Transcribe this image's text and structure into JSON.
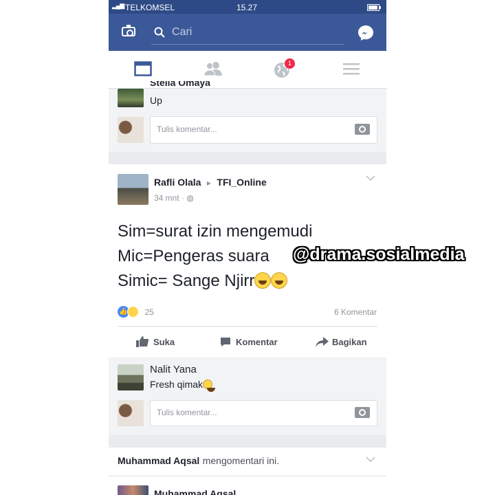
{
  "status_bar": {
    "carrier": "TELKOMSEL",
    "time": "15.27"
  },
  "search": {
    "placeholder": "Cari"
  },
  "tabs": [
    {
      "name": "news-feed"
    },
    {
      "name": "friends"
    },
    {
      "name": "notifications",
      "badge": "1"
    },
    {
      "name": "menu"
    }
  ],
  "prev_post": {
    "commenter_name": "Stella Omaya",
    "comment_text": "Up",
    "comment_placeholder": "Tulis komentar..."
  },
  "post": {
    "author": "Rafli Olala",
    "arrow": "▸",
    "group": "TFI_Online",
    "time": "34 mnt",
    "lines": [
      "Sim=surat izin mengemudi",
      "Mic=Pengeras suara",
      "Simic= Sange Njirr"
    ],
    "reaction_count": "25",
    "comment_count": "6 Komentar",
    "actions": {
      "like": "Suka",
      "comment": "Komentar",
      "share": "Bagikan"
    },
    "top_comment": {
      "name": "Nalit Yana",
      "text": "Fresh qimak"
    },
    "comment_placeholder": "Tulis komentar..."
  },
  "watermark": "@drama.sosialmedia",
  "next_post": {
    "header_name": "Muhammad Aqsal",
    "header_action": "mengomentari ini.",
    "author": "Muhammad Aqsal"
  },
  "colors": {
    "brand": "#3b5998",
    "status_bar": "#2e4a86",
    "badge": "#f02849"
  }
}
